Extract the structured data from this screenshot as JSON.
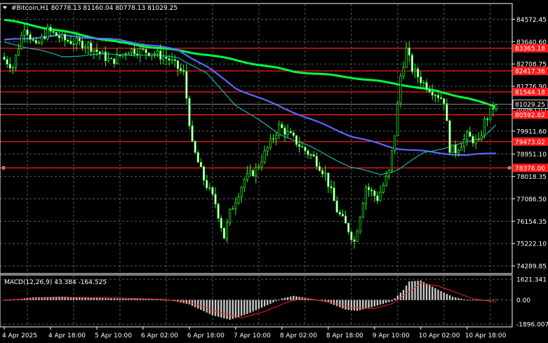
{
  "header": {
    "symbol_line": "#Bitcoin,H1  80778.13 81160.04 80778.13 81029.25"
  },
  "macd": {
    "label": "MACD(12,26,9) 43.384 -164.525",
    "ticks": [
      "1621.341",
      "0.00",
      "-1896.007"
    ],
    "tick_values": [
      1621.341,
      0,
      -1896.007
    ],
    "ylim": [
      -2050,
      1900
    ]
  },
  "chart_data": {
    "type": "candlestick",
    "ylim": [
      74000,
      85200
    ],
    "price_ticks": [
      84572.45,
      83640.6,
      82708.75,
      81776.9,
      80845.05,
      79911.6,
      78951.1,
      78018.35,
      77086.5,
      76154.35,
      75222.1,
      74289.85
    ],
    "price_tick_labels": [
      "84572.45",
      "83640.60",
      "82708.75",
      "81776.90",
      "80845.05",
      "79911.60",
      "78951.10",
      "78018.35",
      "77086.50",
      "76154.35",
      "75222.10",
      "74289.85"
    ],
    "current_price": {
      "value": 81029.25,
      "label": "81029.25"
    },
    "levels": [
      {
        "value": 83365.18,
        "label": "83365.18"
      },
      {
        "value": 82417.36,
        "label": "82417.36"
      },
      {
        "value": 81544.18,
        "label": "81544.18"
      },
      {
        "value": 80592.82,
        "label": "80592.82"
      },
      {
        "value": 79473.02,
        "label": "79473.02"
      },
      {
        "value": 78376.0,
        "label": "78376.00"
      }
    ],
    "x_labels": [
      "4 Apr 2025",
      "4 Apr 18:00",
      "5 Apr 10:00",
      "6 Apr 02:00",
      "6 Apr 18:00",
      "7 Apr 10:00",
      "8 Apr 02:00",
      "8 Apr 18:00",
      "9 Apr 10:00",
      "10 Apr 02:00",
      "10 Apr 18:00"
    ],
    "x_label_positions": [
      0,
      16,
      32,
      48,
      64,
      80,
      96,
      112,
      128,
      144,
      160
    ],
    "anchors": [
      [
        0,
        83000
      ],
      [
        4,
        82600
      ],
      [
        8,
        84300
      ],
      [
        12,
        83400
      ],
      [
        16,
        84100
      ],
      [
        22,
        83700
      ],
      [
        30,
        83500
      ],
      [
        38,
        82800
      ],
      [
        44,
        83300
      ],
      [
        52,
        83200
      ],
      [
        58,
        82900
      ],
      [
        63,
        82300
      ],
      [
        66,
        79300
      ],
      [
        70,
        77900
      ],
      [
        74,
        76900
      ],
      [
        77,
        75500
      ],
      [
        79,
        76500
      ],
      [
        84,
        77900
      ],
      [
        88,
        78300
      ],
      [
        92,
        79200
      ],
      [
        96,
        80100
      ],
      [
        100,
        79700
      ],
      [
        104,
        79200
      ],
      [
        108,
        78800
      ],
      [
        112,
        78100
      ],
      [
        116,
        76600
      ],
      [
        120,
        75800
      ],
      [
        122,
        75300
      ],
      [
        126,
        77600
      ],
      [
        130,
        77100
      ],
      [
        134,
        78200
      ],
      [
        136,
        79800
      ],
      [
        138,
        82200
      ],
      [
        140,
        83300
      ],
      [
        142,
        82500
      ],
      [
        146,
        81900
      ],
      [
        150,
        81500
      ],
      [
        153,
        81200
      ],
      [
        155,
        79200
      ],
      [
        157,
        79100
      ],
      [
        161,
        79700
      ],
      [
        165,
        79400
      ],
      [
        167,
        80300
      ],
      [
        170,
        80900
      ]
    ],
    "overlays": [
      {
        "color": "#00ff3c",
        "width": 3,
        "points": [
          [
            0,
            84550
          ],
          [
            40,
            83600
          ],
          [
            70,
            83100
          ],
          [
            100,
            82400
          ],
          [
            120,
            82150
          ],
          [
            140,
            81800
          ],
          [
            160,
            81300
          ],
          [
            170,
            80900
          ]
        ]
      },
      {
        "color": "#5a68ff",
        "width": 2.2,
        "points": [
          [
            0,
            83700
          ],
          [
            20,
            83900
          ],
          [
            40,
            83700
          ],
          [
            60,
            83300
          ],
          [
            70,
            82600
          ],
          [
            80,
            81700
          ],
          [
            100,
            80700
          ],
          [
            120,
            79700
          ],
          [
            135,
            79200
          ],
          [
            150,
            79000
          ],
          [
            160,
            78900
          ],
          [
            170,
            79000
          ]
        ]
      },
      {
        "color": "#1aa5a0",
        "width": 1.3,
        "points": [
          [
            0,
            83600
          ],
          [
            12,
            83300
          ],
          [
            20,
            83000
          ],
          [
            30,
            83100
          ],
          [
            45,
            83100
          ],
          [
            60,
            83000
          ],
          [
            70,
            82300
          ],
          [
            80,
            81000
          ],
          [
            95,
            79800
          ],
          [
            105,
            79300
          ],
          [
            120,
            78400
          ],
          [
            130,
            78100
          ],
          [
            136,
            78300
          ],
          [
            145,
            79000
          ],
          [
            155,
            79300
          ],
          [
            165,
            79600
          ],
          [
            170,
            80200
          ]
        ]
      }
    ],
    "macd_hist_anchors": [
      [
        0,
        -50
      ],
      [
        10,
        200
      ],
      [
        20,
        260
      ],
      [
        30,
        160
      ],
      [
        40,
        100
      ],
      [
        50,
        80
      ],
      [
        58,
        -50
      ],
      [
        64,
        -350
      ],
      [
        72,
        -1200
      ],
      [
        78,
        -1550
      ],
      [
        84,
        -1100
      ],
      [
        92,
        -300
      ],
      [
        96,
        120
      ],
      [
        100,
        320
      ],
      [
        106,
        80
      ],
      [
        112,
        -200
      ],
      [
        118,
        -750
      ],
      [
        122,
        -850
      ],
      [
        128,
        -500
      ],
      [
        134,
        -100
      ],
      [
        138,
        800
      ],
      [
        140,
        1450
      ],
      [
        144,
        1520
      ],
      [
        150,
        800
      ],
      [
        155,
        250
      ],
      [
        160,
        0
      ],
      [
        165,
        -50
      ],
      [
        170,
        43
      ]
    ],
    "macd_signal_anchors": [
      [
        0,
        0
      ],
      [
        15,
        150
      ],
      [
        25,
        200
      ],
      [
        40,
        150
      ],
      [
        55,
        50
      ],
      [
        65,
        -250
      ],
      [
        75,
        -1000
      ],
      [
        82,
        -1400
      ],
      [
        90,
        -900
      ],
      [
        98,
        -150
      ],
      [
        104,
        150
      ],
      [
        112,
        -150
      ],
      [
        120,
        -600
      ],
      [
        128,
        -650
      ],
      [
        134,
        -300
      ],
      [
        139,
        500
      ],
      [
        144,
        1300
      ],
      [
        150,
        1100
      ],
      [
        156,
        600
      ],
      [
        162,
        100
      ],
      [
        170,
        -164
      ]
    ]
  }
}
